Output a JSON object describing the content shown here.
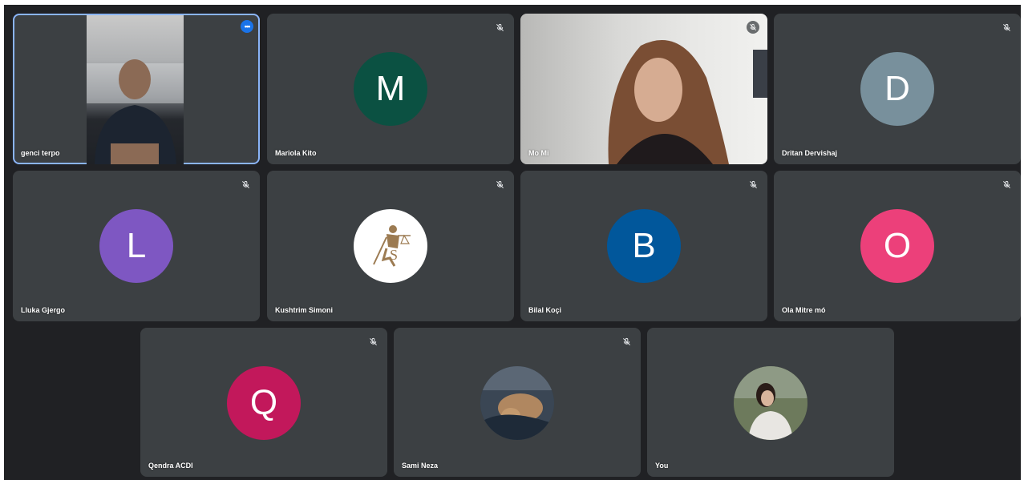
{
  "participants": [
    {
      "name": "genci terpo",
      "type": "video",
      "active": true,
      "mic": "none"
    },
    {
      "name": "Mariola Kito",
      "type": "letter",
      "letter": "M",
      "color": "#0b5142",
      "mic": "muted"
    },
    {
      "name": "Mo Mi",
      "type": "video",
      "mic": "muted"
    },
    {
      "name": "Dritan Dervishaj",
      "type": "letter",
      "letter": "D",
      "color": "#78909c",
      "mic": "muted"
    },
    {
      "name": "Lluka Gjergo",
      "type": "letter",
      "letter": "L",
      "color": "#7e57c2",
      "mic": "muted"
    },
    {
      "name": "Kushtrim Simoni",
      "type": "logo",
      "mic": "muted"
    },
    {
      "name": "Bilal Koçi",
      "type": "letter",
      "letter": "B",
      "color": "#01579b",
      "mic": "muted"
    },
    {
      "name": "Ola Mitre mó",
      "type": "letter",
      "letter": "O",
      "color": "#ec407a",
      "mic": "muted"
    },
    {
      "name": "Qendra ACDI",
      "type": "letter",
      "letter": "Q",
      "color": "#c2185b",
      "mic": "muted"
    },
    {
      "name": "Sami Neza",
      "type": "photo",
      "mic": "muted"
    },
    {
      "name": "You",
      "type": "photo",
      "mic": "none"
    }
  ],
  "icons": {
    "muted": "mic-off-icon",
    "menu": "more-options-icon"
  },
  "colors": {
    "background": "#202124",
    "tile": "#3c4043",
    "active_border": "#8ab4f8",
    "menu_button": "#1a73e8"
  }
}
